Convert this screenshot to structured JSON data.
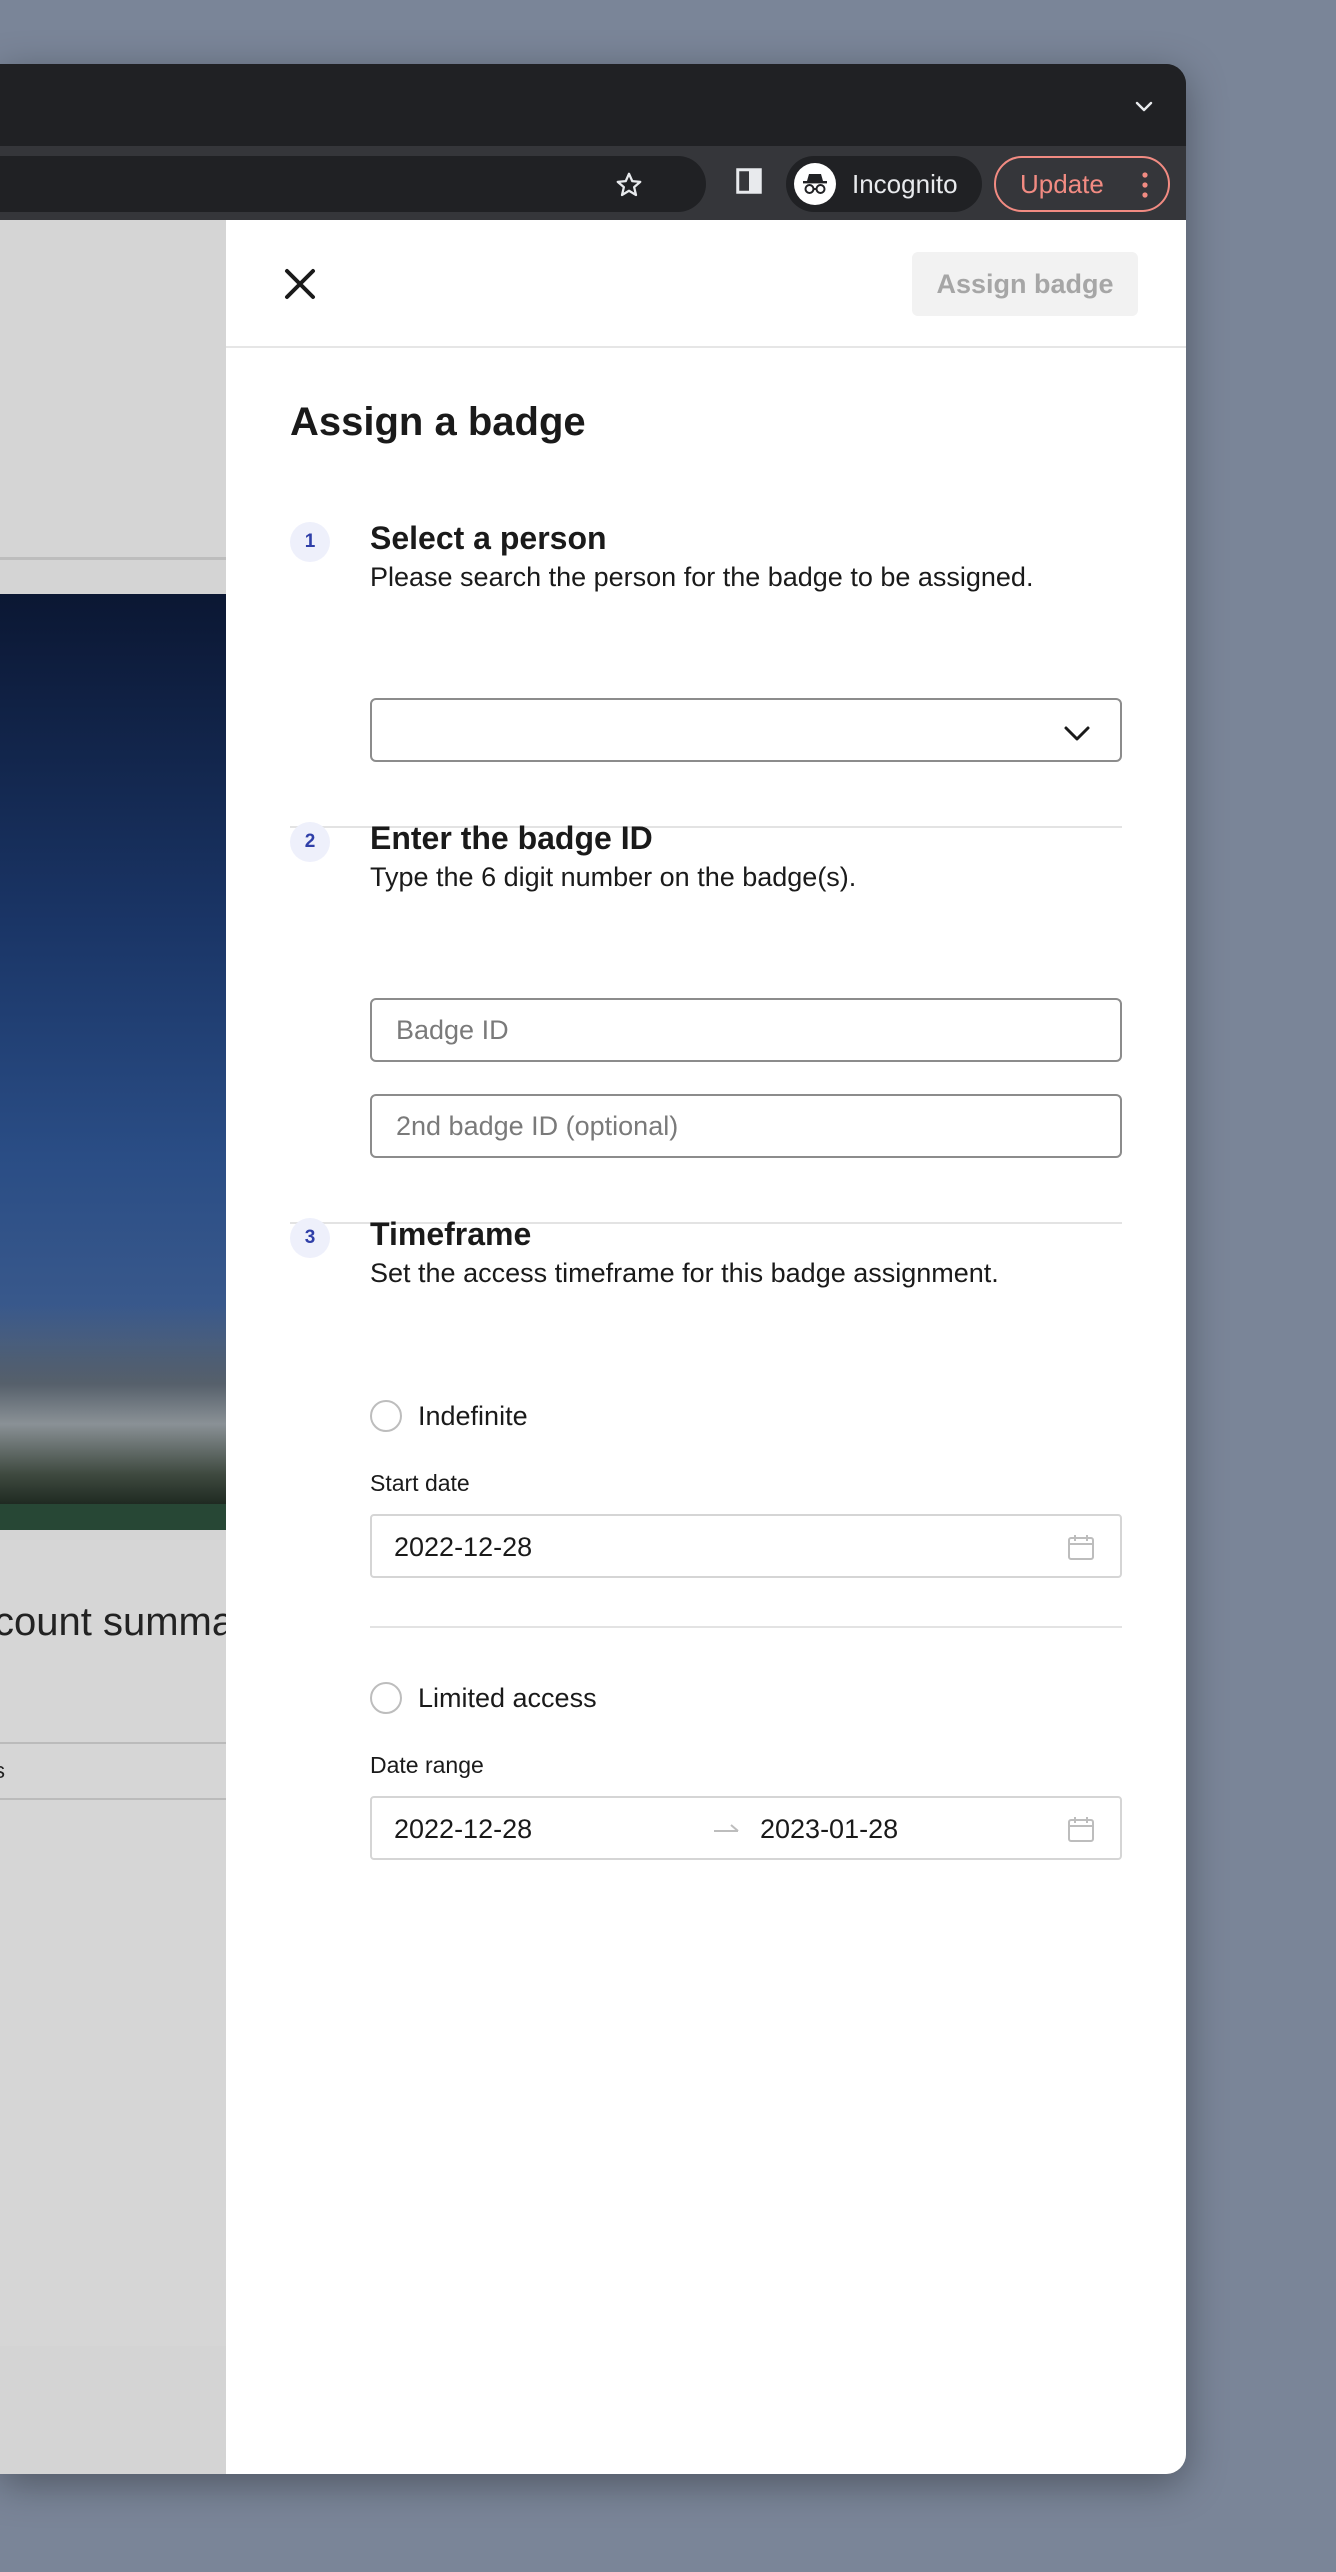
{
  "browser": {
    "incognito_label": "Incognito",
    "update_label": "Update"
  },
  "background_page": {
    "summary_title": "count summa",
    "summary_cell": "s"
  },
  "drawer": {
    "assign_button_label": "Assign badge",
    "title": "Assign a badge",
    "steps": [
      {
        "number": "1",
        "title": "Select a person",
        "description": "Please search the person for the badge to be assigned.",
        "select_value": ""
      },
      {
        "number": "2",
        "title": "Enter the badge ID",
        "description": "Type the 6 digit number on the badge(s).",
        "badge_id_placeholder": "Badge ID",
        "badge_id_2_placeholder": "2nd badge ID (optional)"
      },
      {
        "number": "3",
        "title": "Timeframe",
        "description": "Set the access timeframe for this badge assignment.",
        "indefinite_label": "Indefinite",
        "start_date_label": "Start date",
        "start_date_value": "2022-12-28",
        "limited_label": "Limited access",
        "date_range_label": "Date range",
        "range_start": "2022-12-28",
        "range_end": "2023-01-28"
      }
    ]
  },
  "colors": {
    "step_badge_bg": "#eef0fb",
    "step_badge_text": "#2f3fa8",
    "update_accent": "#f28b82",
    "disabled_button_text": "#a6a6a6"
  },
  "icons": [
    "chevron-down-icon",
    "star-icon",
    "side-panel-icon",
    "incognito-icon",
    "kebab-menu-icon",
    "close-icon",
    "calendar-icon",
    "arrow-right-icon"
  ]
}
